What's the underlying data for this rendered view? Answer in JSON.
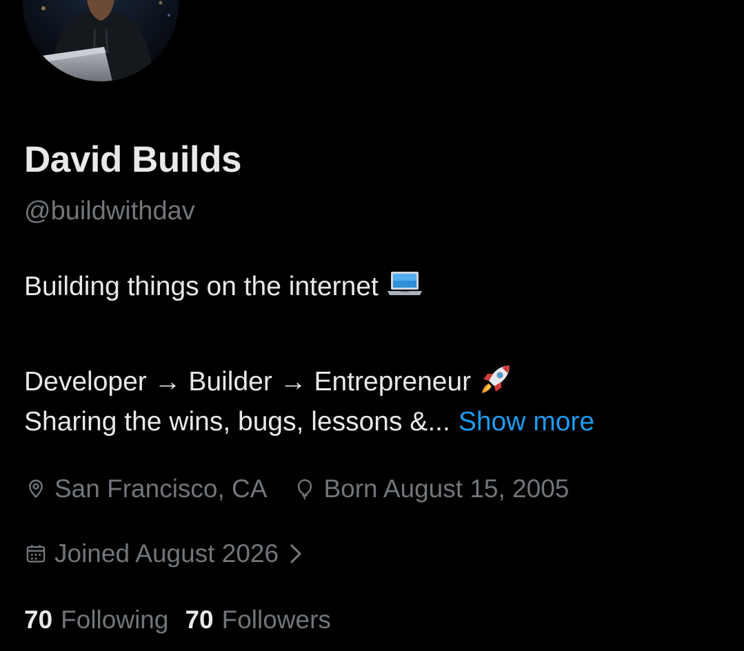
{
  "profile": {
    "display_name": "David Builds",
    "handle": "@buildwithdav",
    "avatar_icon": "profile-photo-hooded-person-laptop"
  },
  "bio": {
    "line1": "Building things on the internet",
    "line1_emoji": "laptop-emoji",
    "line2": "Developer → Builder → Entrepreneur",
    "line2_emoji": "rocket-emoji",
    "line3": "Sharing the wins, bugs, lessons &...",
    "show_more": "Show more"
  },
  "meta": {
    "location": "San Francisco, CA",
    "location_icon": "location-pin-icon",
    "birthday": "Born August 15, 2005",
    "birthday_icon": "balloon-icon",
    "joined": "Joined August 2026",
    "joined_icon": "calendar-icon"
  },
  "stats": {
    "following_count": "70",
    "following_label": "Following",
    "followers_count": "70",
    "followers_label": "Followers"
  },
  "colors": {
    "background": "#000000",
    "primary_text": "#e7e9ea",
    "secondary_text": "#71767b",
    "link": "#1d9bf0"
  }
}
